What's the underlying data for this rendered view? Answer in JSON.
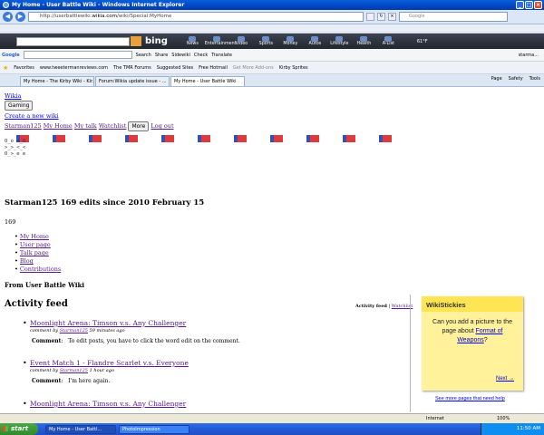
{
  "window": {
    "title": "My Home - User Battle Wiki - Windows Internet Explorer"
  },
  "address": {
    "prefix": "http://userbattlewiki.",
    "domain": "wikia.com",
    "path": "/wiki/Special:MyHome",
    "search_placeholder": "Google"
  },
  "bing": {
    "logo": "bing",
    "items": [
      "News",
      "Entertainment",
      "Video",
      "Sports",
      "Money",
      "Autos",
      "Lifestyle",
      "Health",
      "A-List"
    ],
    "temperature": "61°F"
  },
  "google_bar": {
    "label": "Google",
    "items": [
      "Search",
      "Share",
      "Sidewiki",
      "Check",
      "Translate"
    ],
    "user": "starma..."
  },
  "favorites": {
    "label": "Favorites",
    "items": [
      "www.tweetermanreviews.com",
      "The TMR Forums",
      "Suggested Sites",
      "Free Hotmail",
      "Get More Add-ons",
      "Kirby Sprites"
    ]
  },
  "tabs": [
    {
      "label": "My Home - The Kirby Wiki - Kir...",
      "active": false
    },
    {
      "label": "Forum:Wikia update issue - ...",
      "active": false
    },
    {
      "label": "My Home - User Battle Wiki",
      "active": true
    }
  ],
  "tab_tools": [
    "Page",
    "Safety",
    "Tools"
  ],
  "page": {
    "wikia_link": "Wikia",
    "gaming_button": "Gaming",
    "create_wiki": "Create a new wiki",
    "user_links": [
      "Starman125",
      "My Home",
      "My talk",
      "Watchlist"
    ],
    "more_button": "More",
    "logout": "Log out",
    "faces": [
      "O_o o_O",
      ">_>_<_<",
      "O_>_e e"
    ],
    "username": "Starman125",
    "edits": "169 edits since 2010 February 15",
    "count": "169",
    "user_menu": [
      "My Home",
      "User page",
      "Talk page",
      "Blog",
      "Contributions"
    ],
    "from": "From User Battle Wiki",
    "activity_title": "Activity feed",
    "feed_tabs": {
      "current": "Activity feed",
      "sep": " | ",
      "watchlist": "Watchlist"
    },
    "feed": [
      {
        "title": "Moonlight Arena: Timson v.s. Any Challenger",
        "meta_prefix": "comment by ",
        "user": "Starman125",
        "time": "59 minutes ago",
        "comment_label": "Comment",
        "comment": "To edit posts, you have to click the word edit on the comment."
      },
      {
        "title": "Event Match 1 - Flandre Scarlet v.s. Everyone",
        "meta_prefix": "comment by ",
        "user": "Starman125",
        "time": "1 hour ago",
        "comment_label": "Comment",
        "comment": "I'm here again."
      },
      {
        "title": "Moonlight Arena: Timson v.s. Any Challenger"
      }
    ]
  },
  "sticky": {
    "title": "WikiStickies",
    "text1": "Can you add a picture to the page about",
    "link": "Format of Weapons",
    "text2": "?",
    "next": "Next →",
    "more": "See more pages that need help"
  },
  "status": {
    "zone": "Internet",
    "zoom": "100%"
  },
  "taskbar": {
    "start": "start",
    "tasks": [
      "My Home - User Battl...",
      "PhotoImpression"
    ],
    "clock": "11:50 AM"
  }
}
